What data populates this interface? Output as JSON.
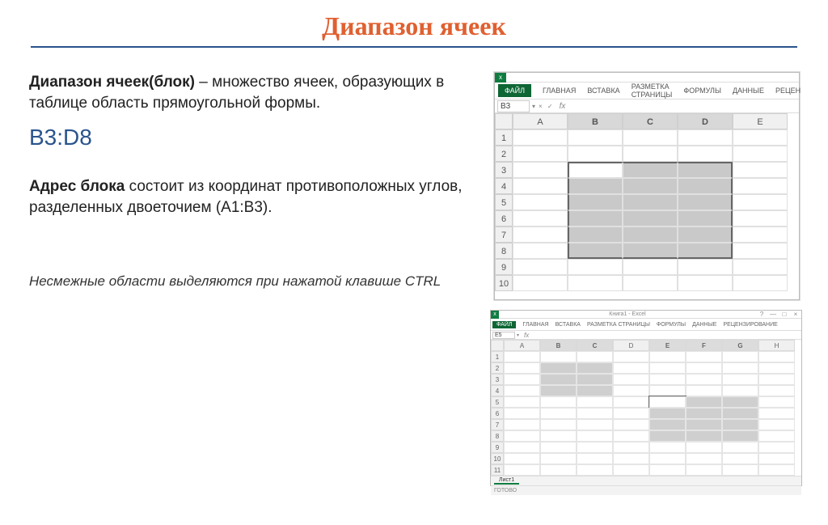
{
  "title": "Диапазон ячеек",
  "para1_bold": "Диапазон ячеек(блок)",
  "para1_rest": " – множество ячеек, образующих в таблице область прямоугольной формы.",
  "range_ref": "В3:D8",
  "para2_bold": "Адрес блока",
  "para2_rest": " состоит из координат противоположных углов, разделенных двоеточием (А1:В3).",
  "para3": "Несмежные области выделяются при нажатой клавише CTRL",
  "excel1": {
    "x_label": "x",
    "file_tab": "ФАЙЛ",
    "ribbon": [
      "ГЛАВНАЯ",
      "ВСТАВКА",
      "РАЗМЕТКА СТРАНИЦЫ",
      "ФОРМУЛЫ",
      "ДАННЫЕ",
      "РЕЦЕН"
    ],
    "name_box": "B3",
    "fx_icons": "× ✓",
    "fx": "fx",
    "cols": [
      "A",
      "B",
      "C",
      "D",
      "E"
    ],
    "rows": [
      "1",
      "2",
      "3",
      "4",
      "5",
      "6",
      "7",
      "8",
      "9",
      "10"
    ],
    "selection": "B3:D8"
  },
  "excel2": {
    "doc_title": "Книга1 - Excel",
    "file_tab": "ФАЙЛ",
    "ribbon": [
      "ГЛАВНАЯ",
      "ВСТАВКА",
      "РАЗМЕТКА СТРАНИЦЫ",
      "ФОРМУЛЫ",
      "ДАННЫЕ",
      "РЕЦЕНЗИРОВАНИЕ"
    ],
    "name_box": "E5",
    "fx": "fx",
    "cols": [
      "A",
      "B",
      "C",
      "D",
      "E",
      "F",
      "G",
      "H"
    ],
    "rows": [
      "1",
      "2",
      "3",
      "4",
      "5",
      "6",
      "7",
      "8",
      "9",
      "10",
      "11"
    ],
    "sheet_tab": "Лист1",
    "status": "ГОТОВО",
    "selections": [
      "B2:C4",
      "E5:G8"
    ]
  }
}
